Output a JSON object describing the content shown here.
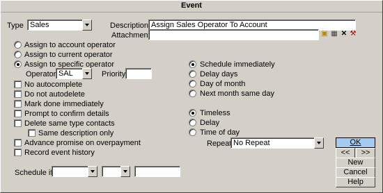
{
  "window": {
    "title": "Event"
  },
  "type": {
    "label": "Type",
    "value": "Sales"
  },
  "description": {
    "label": "Description",
    "value": "Assign Sales Operator To Account"
  },
  "attachment": {
    "label": "Attachment",
    "value": ""
  },
  "assign": {
    "options": [
      {
        "label": "Assign to account operator",
        "selected": false
      },
      {
        "label": "Assign to current operator",
        "selected": false
      },
      {
        "label": "Assign to specific operator",
        "selected": true
      }
    ],
    "operator_label": "Operator",
    "operator_value": "SAL",
    "priority_label": "Priority",
    "priority_value": ""
  },
  "checkboxes": {
    "no_autocomplete": "No autocomplete",
    "do_not_autodelete": "Do not autodelete",
    "mark_done": "Mark done immediately",
    "prompt_confirm": "Prompt to confirm details",
    "delete_same_type": "Delete same type contacts",
    "same_description": "Same description only",
    "advance_promise": "Advance promise on overpayment",
    "record_history": "Record event history"
  },
  "schedule": {
    "options": [
      {
        "label": "Schedule immediately",
        "selected": true
      },
      {
        "label": "Delay days",
        "selected": false
      },
      {
        "label": "Day of month",
        "selected": false
      },
      {
        "label": "Next month same day",
        "selected": false
      }
    ]
  },
  "time": {
    "options": [
      {
        "label": "Timeless",
        "selected": true
      },
      {
        "label": "Delay",
        "selected": false
      },
      {
        "label": "Time of day",
        "selected": false
      }
    ],
    "repeat_label": "Repeat",
    "repeat_value": "No Repeat"
  },
  "schedule_if": {
    "label": "Schedule if",
    "field1": "",
    "field2": "",
    "field3": ""
  },
  "buttons": {
    "ok": "OK",
    "prev": "<<",
    "next": ">>",
    "new": "New",
    "cancel": "Cancel",
    "help": "Help"
  }
}
